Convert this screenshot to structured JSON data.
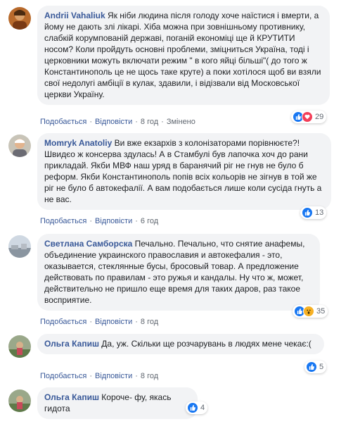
{
  "colors": {
    "link": "#385898",
    "bubble": "#f2f3f5",
    "like": "#1877f2",
    "love": "#f33e58",
    "wow": "#f7b125"
  },
  "comments": [
    {
      "author": "Andrii Vahaliuk",
      "text": "Як ніби людина після голоду хоче наїстися і вмерти, а йому не дають злі лікарі. Хіба можна при зовнішньому противнику, слабкій корумпованій державі, поганій економіці ще й КРУТИТИ носом? Коли пройдуть основні проблеми, зміцниться Україна, тоді і церковники можуть включати режим \" в кого яйці більші\"( до того ж Константинополь це не щось таке круте) а поки хотілося щоб ви взяли свої недолугі амбіції в кулак, здавили, і відізвали від Московської церкви Україну.",
      "like": "Подобається",
      "reply": "Відповісти",
      "time": "8 год",
      "edited": "Змінено",
      "reactions": [
        "like-icon",
        "love-icon"
      ],
      "count": "29"
    },
    {
      "author": "Momryk Anatoliy",
      "text": "Ви вже екзархів з колонізаторами порівнюєте?! Швидєо ж консерва здулась! А в Стамбулі був лапочка хоч до рани прикладай. Якби МВФ наш уряд в баранячий ріг не гнув не було б реформ. Якби Константинополь попів всіх кольорів не зігнув в той же ріг не було б автокефалії. А вам подобається лише коли сусіда гнуть а не вас.",
      "like": "Подобається",
      "reply": "Відповісти",
      "time": "6 год",
      "reactions": [
        "like-icon"
      ],
      "count": "13"
    },
    {
      "author": "Светлана Самборска",
      "text": "Печально. Печально, что снятие анафемы, объединение украинского православия и автокефалия - это, оказывается, стеклянные бусы, бросовый товар. А предложение действовать по правилам - это ружья и кандалы. Ну что ж, может, действительно не пришло еще время для таких даров, раз такое восприятие.",
      "like": "Подобається",
      "reply": "Відповісти",
      "time": "8 год",
      "reactions": [
        "like-icon",
        "wow-icon"
      ],
      "count": "35"
    },
    {
      "author": "Ольга Капиш",
      "text": "Да, уж. Скільки ще розчарувань в людях мене чекає:(",
      "like": "Подобається",
      "reply": "Відповісти",
      "time": "8 год",
      "reactions": [
        "like-icon"
      ],
      "count": "5"
    },
    {
      "author": "Ольга Капиш",
      "text": "Короче- фу, якась гидота",
      "reactions": [
        "like-icon"
      ],
      "count": "4"
    }
  ]
}
